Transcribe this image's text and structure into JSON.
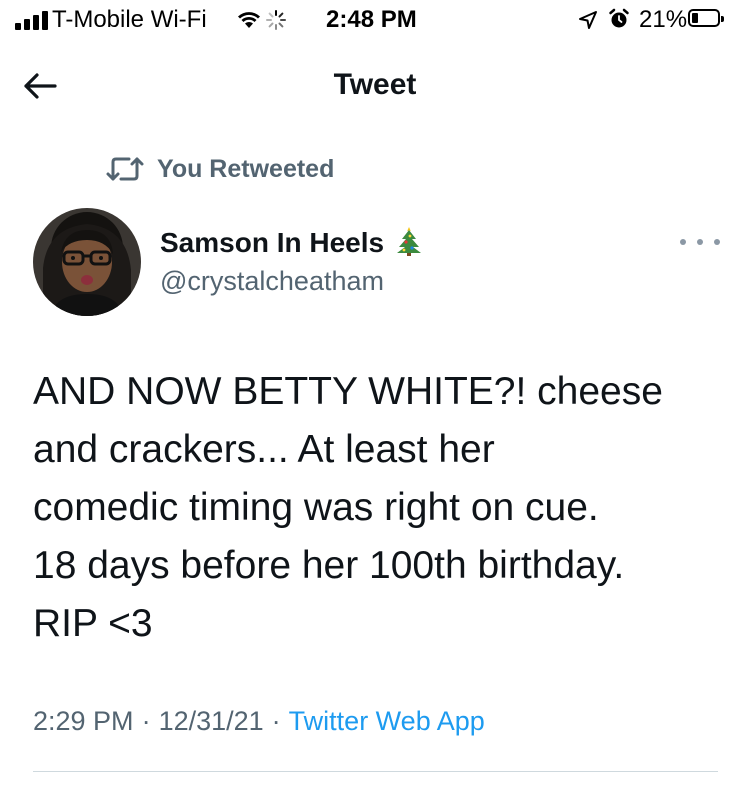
{
  "status_bar": {
    "carrier": "T-Mobile Wi-Fi",
    "time": "2:48 PM",
    "battery": "21%"
  },
  "header": {
    "title": "Tweet",
    "back_icon": "arrow-left-icon"
  },
  "retweet": {
    "icon": "retweet-icon",
    "label": "You Retweeted"
  },
  "tweet": {
    "author_name": "Samson In Heels",
    "author_emoji_icon": "christmas-tree-icon",
    "author_handle": "@crystalcheatham",
    "text": "AND NOW BETTY WHITE?! cheese\nand crackers... At least her\ncomedic timing was right on cue.\n18 days before her 100th birthday.\nRIP <3",
    "time": "2:29 PM",
    "date": "12/31/21",
    "source": "Twitter Web App"
  },
  "colors": {
    "text_primary": "#0f1419",
    "text_secondary": "#536471",
    "link": "#1d9bf0",
    "divider": "#cfd9de"
  }
}
